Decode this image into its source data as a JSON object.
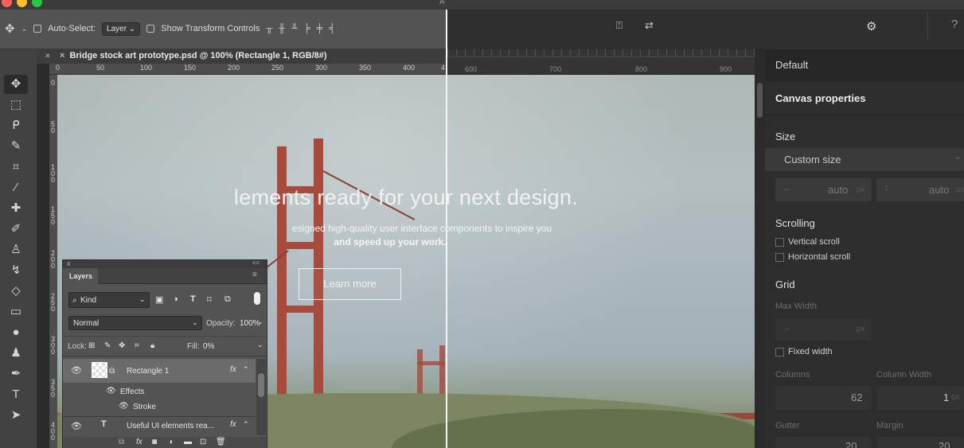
{
  "ps": {
    "window_title_fragment": "A",
    "options": {
      "auto_select_label": "Auto-Select:",
      "auto_select_value": "Layer",
      "show_transform_label": "Show Transform Controls"
    },
    "document_tab": "Bridge stock art prototype.psd @ 100% (Rectangle 1, RGB/8#)",
    "ruler_top": [
      "0",
      "50",
      "100",
      "150",
      "200",
      "250",
      "300",
      "350",
      "400",
      "4"
    ],
    "ruler_left": [
      "0",
      "5\n0",
      "1\n0\n0",
      "1\n5\n0",
      "2\n0\n0",
      "2\n5\n0",
      "3\n0\n0",
      "3\n5\n0",
      "4\n0\n0"
    ]
  },
  "app_ruler": [
    "600",
    "700",
    "800",
    "900"
  ],
  "canvas": {
    "hero_title": "lements ready for your next design.",
    "hero_subtitle_1": "esigned high-quality user interface components to inspire you",
    "hero_subtitle_2": "and speed up your work.",
    "hero_button": "Learn more"
  },
  "layers": {
    "close_glyph": "x",
    "collapse_glyph": "<<",
    "tab": "Layers",
    "filter": "Kind",
    "blend_mode": "Normal",
    "opacity_label": "Opacity:",
    "opacity_value": "100%",
    "lock_label": "Lock:",
    "fill_label": "Fill:",
    "fill_value": "0%",
    "items": [
      {
        "name": "Rectangle 1",
        "fx": "fx"
      },
      {
        "name": "Effects"
      },
      {
        "name": "Stroke"
      },
      {
        "name": "Useful UI elements rea...",
        "fx": "fx"
      }
    ]
  },
  "props": {
    "preset": "Default",
    "section": "Canvas properties",
    "size_label": "Size",
    "size_value": "Custom size",
    "width_value": "auto",
    "height_value": "auto",
    "unit": "px",
    "scrolling_label": "Scrolling",
    "vertical_scroll": "Vertical scroll",
    "horizontal_scroll": "Horizontal scroll",
    "grid_label": "Grid",
    "max_width_label": "Max Width",
    "max_width_unit": "px",
    "fixed_width": "Fixed width",
    "columns_label": "Columns",
    "column_width_label": "Column Width",
    "columns_value": "62",
    "column_width_value": "1",
    "gutter_label": "Gutter",
    "margin_label": "Margin",
    "gutter_value": "20",
    "margin_value": "20"
  },
  "topbar": {
    "help": "?"
  },
  "colors": {
    "accent_red": "#ff5f57",
    "accent_yellow": "#febc2e",
    "accent_green": "#28c840"
  }
}
